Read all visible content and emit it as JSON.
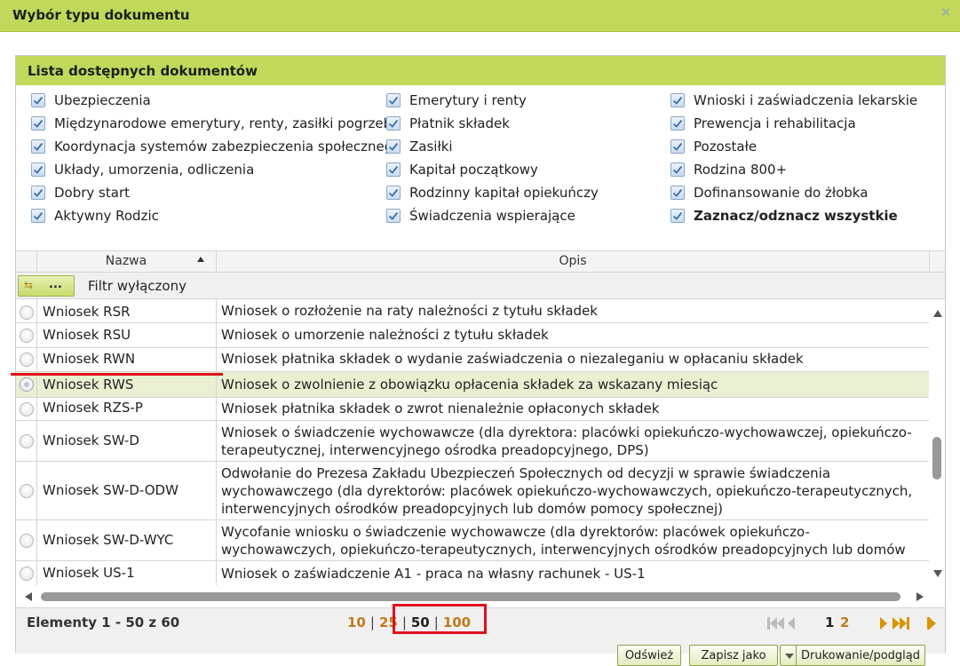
{
  "dialog": {
    "title": "Wybór typu dokumentu",
    "close_symbol": "×"
  },
  "panel": {
    "title": "Lista dostępnych dokumentów"
  },
  "categories": {
    "col1": [
      "Ubezpieczenia",
      "Międzynarodowe emerytury, renty, zasiłki pogrzeb.",
      "Koordynacja systemów zabezpieczenia społecznego",
      "Układy, umorzenia, odliczenia",
      "Dobry start",
      "Aktywny Rodzic"
    ],
    "col2": [
      "Emerytury i renty",
      "Płatnik składek",
      "Zasiłki",
      "Kapitał początkowy",
      "Rodzinny kapitał opiekuńczy",
      "Świadczenia wspierające"
    ],
    "col3": [
      "Wnioski i zaświadczenia lekarskie",
      "Prewencja i rehabilitacja",
      "Pozostałe",
      "Rodzina 800+",
      "Dofinansowanie do żłobka",
      "Zaznacz/odznacz wszystkie"
    ],
    "all_checked": true
  },
  "grid": {
    "columns": {
      "name": "Nazwa",
      "desc": "Opis"
    },
    "sort": "ascending",
    "filter": {
      "button_label": "...",
      "status": "Filtr wyłączony",
      "icon": "filter-icon"
    },
    "selected_row": "Wniosek RWS",
    "rows": [
      {
        "name": "Wniosek RSR",
        "desc": "Wniosek o rozłożenie na raty należności z tytułu składek"
      },
      {
        "name": "Wniosek RSU",
        "desc": "Wniosek o umorzenie należności z tytułu składek"
      },
      {
        "name": "Wniosek RWN",
        "desc": "Wniosek płatnika składek o wydanie zaświadczenia o niezaleganiu w opłacaniu składek"
      },
      {
        "name": "Wniosek RWS",
        "desc": "Wniosek o zwolnienie z obowiązku opłacenia składek za wskazany miesiąc"
      },
      {
        "name": "Wniosek RZS-P",
        "desc": "Wniosek płatnika składek o zwrot nienależnie opłaconych składek"
      },
      {
        "name": "Wniosek SW-D",
        "desc": "Wniosek o świadczenie wychowawcze (dla dyrektora: placówki opiekuńczo-wychowawczej, opiekuńczo-terapeutycznej, interwencyjnego ośrodka preadopcyjnego, DPS)"
      },
      {
        "name": "Wniosek SW-D-ODW",
        "desc": "Odwołanie do Prezesa Zakładu Ubezpieczeń Społecznych od decyzji w sprawie świadczenia wychowawczego (dla dyrektorów: placówek opiekuńczo-wychowawczych, opiekuńczo-terapeutycznych, interwencyjnych ośrodków preadopcyjnych lub domów pomocy społecznej)"
      },
      {
        "name": "Wniosek SW-D-WYC",
        "desc": "Wycofanie wniosku o świadczenie wychowawcze (dla dyrektorów: placówek opiekuńczo-wychowawczych, opiekuńczo-terapeutycznych, interwencyjnych ośrodków preadopcyjnych lub domów pomocy społecznej)"
      },
      {
        "name": "Wniosek US-1",
        "desc": "Wniosek o zaświadczenie A1 - praca na własny rachunek - US-1"
      }
    ]
  },
  "pager": {
    "range": "Elementy 1 - 50 z 60",
    "page_sizes": [
      "10",
      "25",
      "50",
      "100"
    ],
    "active_size": "50",
    "current_page": "1",
    "next_page": "2"
  },
  "buttons": {
    "refresh": "Odśwież",
    "save_as": "Zapisz jako",
    "print": "Drukowanie/podgląd"
  },
  "colors": {
    "header": "#c1d95a",
    "selected_row": "#e9f0d2",
    "link": "#c07a1a",
    "highlight": "#e0101e"
  }
}
